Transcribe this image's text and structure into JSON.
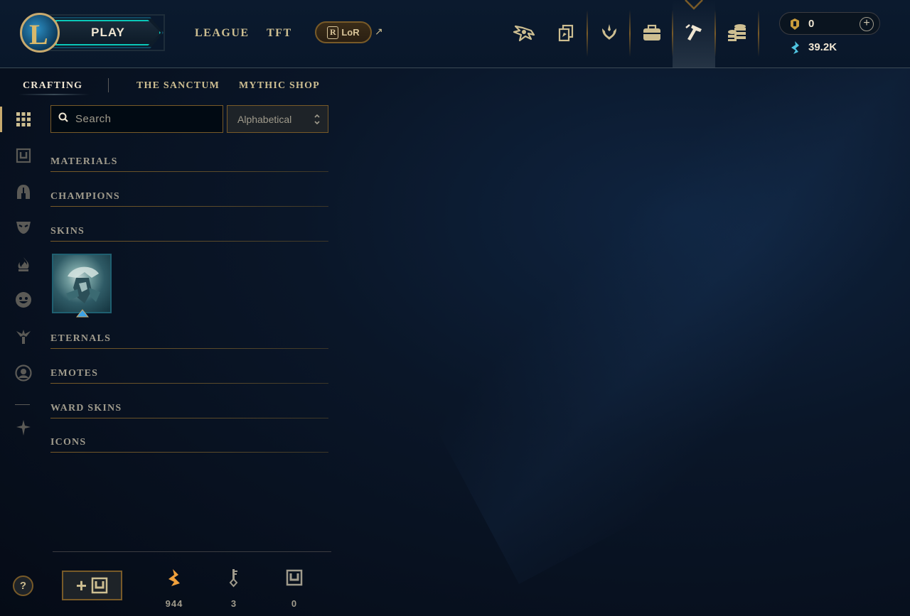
{
  "topbar": {
    "logo_letter": "L",
    "play_label": "PLAY",
    "nav": [
      {
        "label": "LEAGUE"
      },
      {
        "label": "TFT"
      }
    ],
    "lor_label": "LoR",
    "lor_badge": "R",
    "external_arrow": "↗",
    "icons": [
      "profile-icon",
      "collection-icon",
      "tft-icon",
      "store-bag-icon",
      "loot-crafting-icon",
      "currency-coins-icon"
    ],
    "active_icon": "loot-crafting-icon",
    "rp": {
      "value": "0"
    },
    "be": {
      "value": "39.2K"
    },
    "plus": "+"
  },
  "subnav": {
    "tabs": [
      {
        "label": "CRAFTING",
        "active": true
      },
      {
        "label": "THE SANCTUM",
        "active": false
      },
      {
        "label": "MYTHIC SHOP",
        "active": false
      }
    ]
  },
  "sidebar": {
    "icons": [
      "grid-icon",
      "chest-icon",
      "champion-helmet-icon",
      "skin-mask-icon",
      "flame-icon",
      "emote-face-icon",
      "ward-icon",
      "profile-circle-icon",
      "misc-emblem-icon"
    ],
    "active": "grid-icon"
  },
  "filter": {
    "search_placeholder": "Search",
    "sort_value": "Alphabetical"
  },
  "categories": [
    {
      "label": "MATERIALS"
    },
    {
      "label": "CHAMPIONS"
    },
    {
      "label": "SKINS"
    },
    {
      "label": "ETERNALS"
    },
    {
      "label": "EMOTES"
    },
    {
      "label": "WARD SKINS"
    },
    {
      "label": "ICONS"
    }
  ],
  "bottom": {
    "help": "?",
    "add_label": "+",
    "resources": [
      {
        "name": "orange-essence-icon",
        "value": "944",
        "color": "#f0a03c"
      },
      {
        "name": "key-icon",
        "value": "3",
        "color": "#a09b8c"
      },
      {
        "name": "chest-icon",
        "value": "0",
        "color": "#a09b8c"
      }
    ]
  },
  "colors": {
    "gold": "#c8aa6e",
    "teal": "#0ac8b9",
    "background": "#061020"
  }
}
